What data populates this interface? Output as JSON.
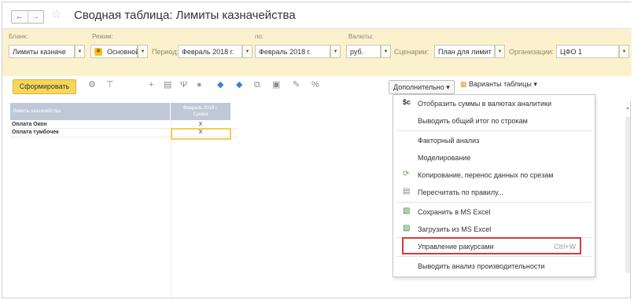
{
  "window": {
    "title": "Сводная таблица: Лимиты казначейства",
    "back_icon": "←",
    "forward_icon": "→",
    "star_icon": "☆"
  },
  "filters": {
    "blank_label": "Бланк:",
    "blank_value": "Лимиты казначе",
    "mode_label": "Режим:",
    "mode_value": "Основной",
    "period_label": "Период:",
    "period_from": "Февраль 2018 г.",
    "to_label": "по:",
    "period_to": "Февраль 2018 г.",
    "currency_label": "Валюты:",
    "currency_value": "руб.",
    "scenario_label": "Сценарии:",
    "scenario_value": "План для лимит",
    "org_label": "Организации:",
    "org_value": "ЦФО 1",
    "dd_glyph": "▼"
  },
  "toolbar": {
    "form_button": "Сформировать",
    "more_button": "Дополнительно",
    "variants_button": "Варианты таблицы",
    "percent": "%"
  },
  "table": {
    "header_left": "Лимиты казначейства",
    "header_right_1": "Февраль 2018 г.",
    "header_right_2": "Сумма",
    "rows": [
      {
        "name": "Оплата Окон",
        "value": "X"
      },
      {
        "name": "Оплата тумбочек",
        "value": "X"
      }
    ]
  },
  "menu": {
    "items": [
      {
        "label": "Отобразить суммы в валютах аналитики",
        "icon": "$c"
      },
      {
        "label": "Выводить общий итог по строкам",
        "icon": ""
      },
      {
        "label": "Факторный анализ",
        "icon": ""
      },
      {
        "label": "Моделирование",
        "icon": ""
      },
      {
        "label": "Копирование, перенос данных по срезам",
        "icon": "copy-icon"
      },
      {
        "label": "Пересчитать по правилу...",
        "icon": "recalc-icon"
      },
      {
        "label": "Сохранить в MS Excel",
        "icon": "excel-icon"
      },
      {
        "label": "Загрузить из MS Excel",
        "icon": "excel-icon"
      },
      {
        "label": "Управление ракурсами",
        "shortcut": "Ctrl+W",
        "icon": ""
      },
      {
        "label": "Выводить анализ производительности",
        "icon": ""
      }
    ],
    "highlight_color": "#d63a3a"
  },
  "colors": {
    "filter_bg": "#fbf2cd",
    "form_button": "#f6d75a",
    "table_header": "#c0c8d7"
  }
}
